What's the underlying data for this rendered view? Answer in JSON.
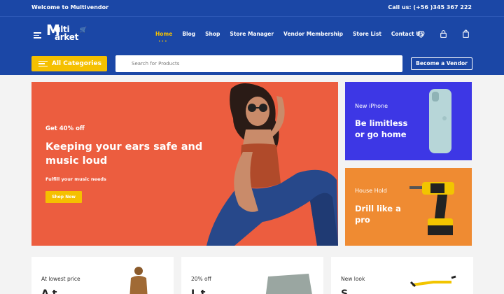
{
  "topbar": {
    "welcome": "Welcome to Multivendor",
    "call": "Call us: (+56 )345 367 222"
  },
  "logo": {
    "line1": "ulti",
    "line2": "arket",
    "initial": "M"
  },
  "nav": [
    {
      "label": "Home",
      "active": true
    },
    {
      "label": "Blog"
    },
    {
      "label": "Shop"
    },
    {
      "label": "Store Manager"
    },
    {
      "label": "Vendor Membership"
    },
    {
      "label": "Store List"
    },
    {
      "label": "Contact Us"
    }
  ],
  "icons": [
    "heart-icon",
    "lock-icon",
    "bag-icon",
    "menu-icon",
    "search-icon"
  ],
  "search": {
    "category_label": "All Categories",
    "placeholder": "Search for Products",
    "vendor_label": "Become a Vendor"
  },
  "hero": {
    "kicker": "Get 40% off",
    "headline": "Keeping your ears safe and music loud",
    "sub": "Fulfill your music needs",
    "cta": "Shop Now"
  },
  "promos": [
    {
      "tag": "New iPhone",
      "head1": "Be limitless",
      "head2": "or go home"
    },
    {
      "tag": "House Hold",
      "head1": "Drill like a",
      "head2": "pro"
    }
  ],
  "cards": [
    {
      "tag": "At lowest price",
      "big": "A t"
    },
    {
      "tag": "20% off",
      "big": "L t"
    },
    {
      "tag": "New look",
      "big": "S"
    }
  ],
  "colors": {
    "header_blue": "#1b47a6",
    "accent_yellow": "#f5c000",
    "hero_orange": "#ec5d3f",
    "promo_blue": "#3d37e5",
    "promo_orange": "#ef8b32"
  }
}
